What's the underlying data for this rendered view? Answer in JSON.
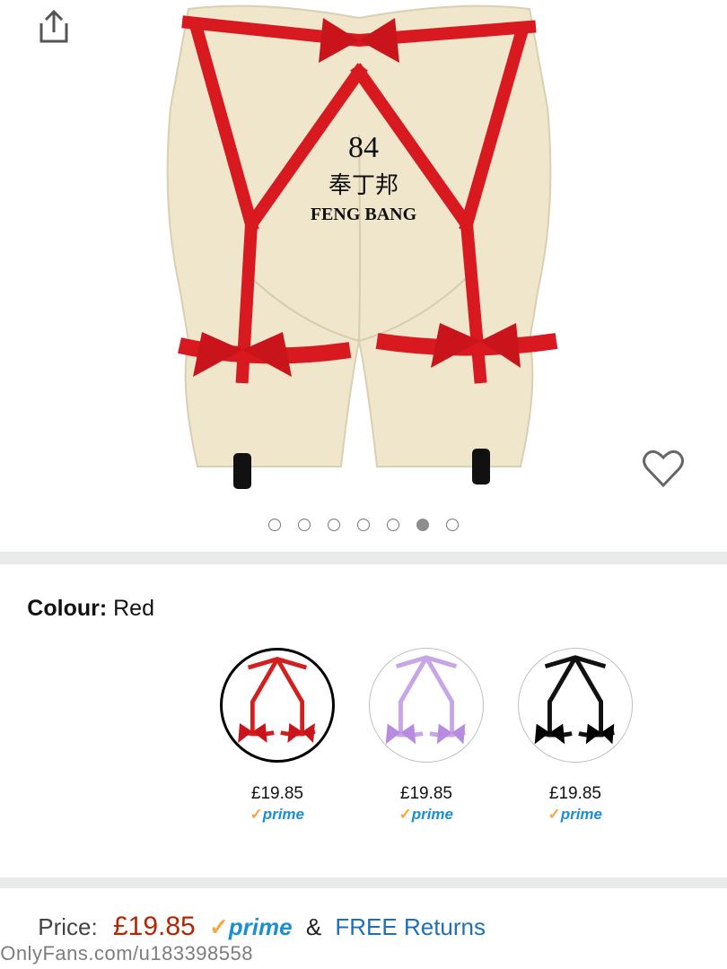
{
  "gallery": {
    "image_count": 7,
    "active_index": 5,
    "mannequin_text": {
      "number": "84",
      "brand_cn": "奉丁邦",
      "brand_en": "FENG BANG"
    }
  },
  "icons": {
    "share": "share-icon",
    "favorite": "heart-icon"
  },
  "colour": {
    "label": "Colour:",
    "value": "Red"
  },
  "swatches": [
    {
      "name": "Red",
      "price": "£19.85",
      "prime": "prime",
      "selected": true,
      "color": "#d41f1f"
    },
    {
      "name": "Lilac",
      "price": "£19.85",
      "prime": "prime",
      "selected": false,
      "color": "#c7a6e8"
    },
    {
      "name": "Black",
      "price": "£19.85",
      "prime": "prime",
      "selected": false,
      "color": "#111111"
    }
  ],
  "price": {
    "label": "Price:",
    "value": "£19.85",
    "prime": "prime",
    "amp": "&",
    "returns": "FREE Returns"
  },
  "watermark": "OnlyFans.com/u183398558",
  "colors": {
    "accent_price": "#b12704",
    "prime_blue": "#1c8fd1",
    "link_blue": "#1f6fb4",
    "prime_check": "#f3a847"
  }
}
